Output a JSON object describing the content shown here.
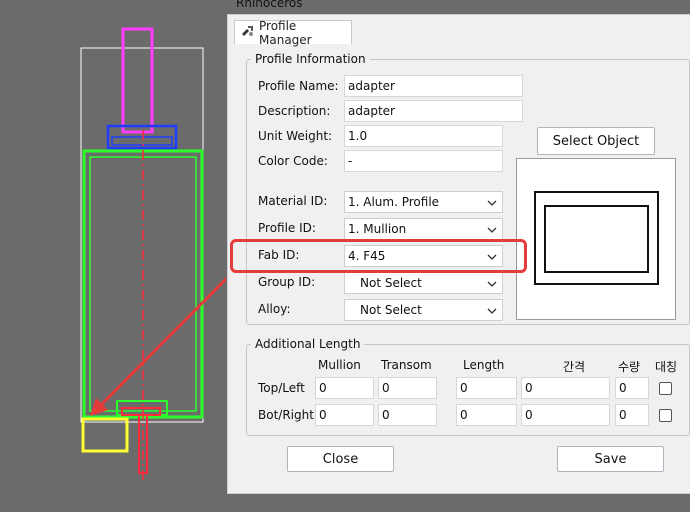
{
  "app": {
    "title": "Rhinoceros"
  },
  "dialog": {
    "tab_label": "Profile Manager"
  },
  "profile_info": {
    "title": "Profile Information",
    "profile_name": {
      "label": "Profile Name:",
      "value": "adapter"
    },
    "description": {
      "label": "Description:",
      "value": "adapter"
    },
    "unit_weight": {
      "label": "Unit Weight:",
      "value": "1.0"
    },
    "color_code": {
      "label": "Color Code:",
      "value": "-"
    },
    "material_id": {
      "label": "Material ID:",
      "value": "1. Alum. Profile"
    },
    "profile_id": {
      "label": "Profile ID:",
      "value": "1. Mullion"
    },
    "fab_id": {
      "label": "Fab ID:",
      "value": "4. F45"
    },
    "group_id": {
      "label": "Group ID:",
      "value": "Not Select"
    },
    "alloy": {
      "label": "Alloy:",
      "value": "Not Select"
    },
    "select_object_label": "Select Object"
  },
  "additional_length": {
    "title": "Additional Length",
    "columns": [
      "Mullion",
      "Transom",
      "Length",
      "간격",
      "수량",
      "대칭"
    ],
    "rows": [
      {
        "label": "Top/Left",
        "values": [
          "0",
          "0",
          "0",
          "0",
          "0"
        ],
        "checked": false
      },
      {
        "label": "Bot/Right",
        "values": [
          "0",
          "0",
          "0",
          "0",
          "0"
        ],
        "checked": false
      }
    ]
  },
  "buttons": {
    "close_label": "Close",
    "save_label": "Save"
  },
  "colors": {
    "magenta": "#ff3cff",
    "blue": "#1f3cff",
    "green": "#2dff2d",
    "red": "#ff2a3c",
    "yellow": "#ffff33",
    "highlight": "#e53b3b"
  }
}
